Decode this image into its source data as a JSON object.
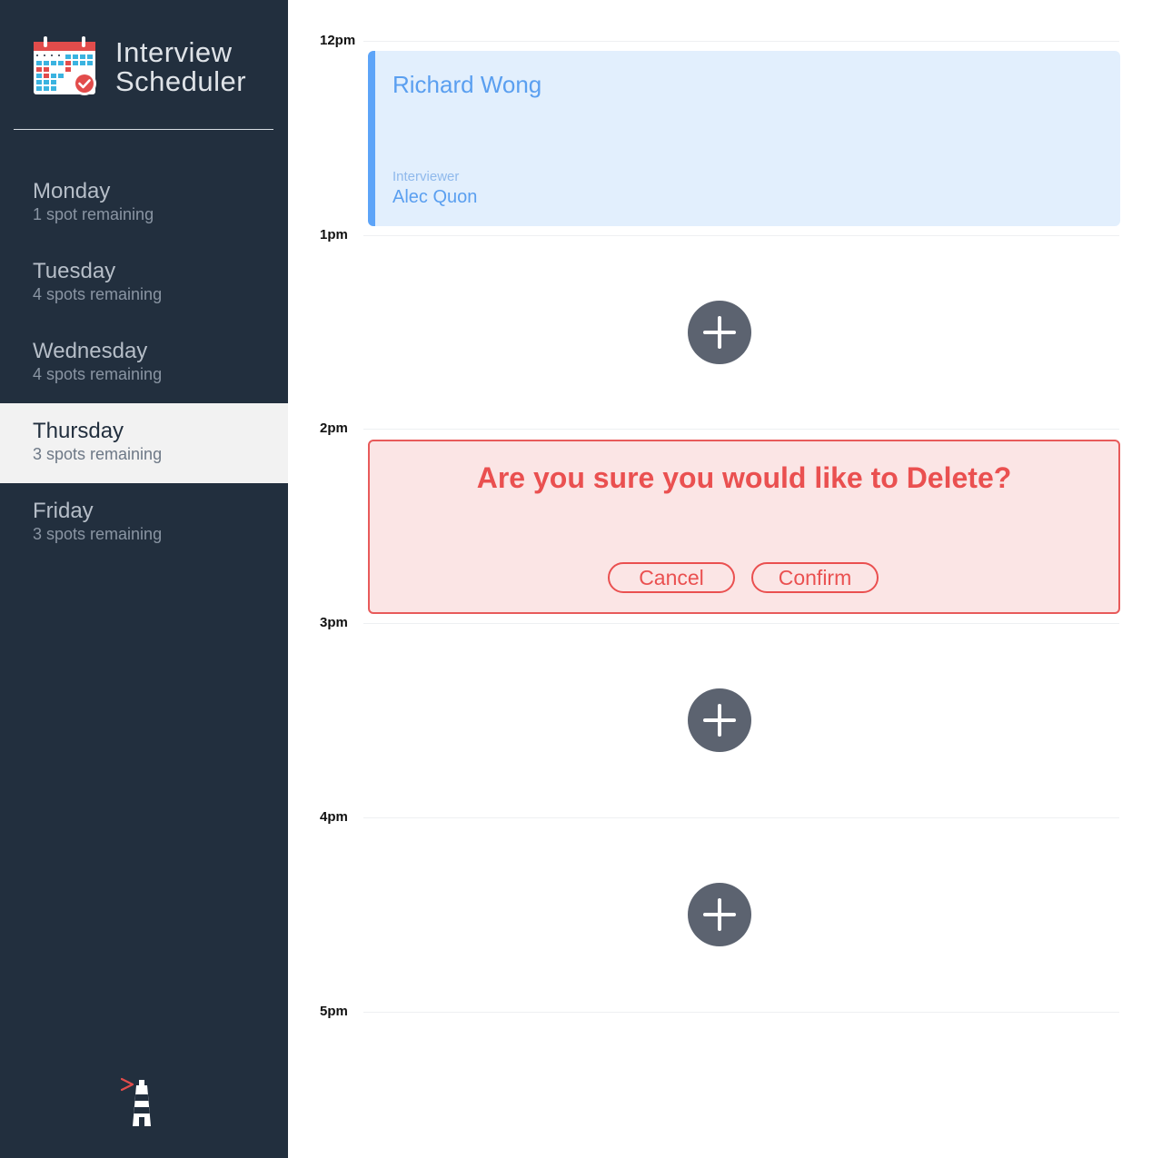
{
  "brand": {
    "title_line1": "Interview",
    "title_line2": "Scheduler"
  },
  "sidebar": {
    "days": [
      {
        "name": "Monday",
        "spots": "1 spot remaining",
        "selected": false
      },
      {
        "name": "Tuesday",
        "spots": "4 spots remaining",
        "selected": false
      },
      {
        "name": "Wednesday",
        "spots": "4 spots remaining",
        "selected": false
      },
      {
        "name": "Thursday",
        "spots": "3 spots remaining",
        "selected": true
      },
      {
        "name": "Friday",
        "spots": "3 spots remaining",
        "selected": false
      }
    ]
  },
  "schedule": {
    "slots": [
      {
        "time": "12pm",
        "type": "appointment",
        "student": "Richard Wong",
        "interviewer_label": "Interviewer",
        "interviewer": "Alec Quon"
      },
      {
        "time": "1pm",
        "type": "empty"
      },
      {
        "time": "2pm",
        "type": "confirm",
        "message": "Are you sure you would like to Delete?",
        "cancel_label": "Cancel",
        "confirm_label": "Confirm"
      },
      {
        "time": "3pm",
        "type": "empty"
      },
      {
        "time": "4pm",
        "type": "empty"
      },
      {
        "time": "5pm",
        "type": "end"
      }
    ]
  },
  "icons": {
    "logo": "calendar-check-icon",
    "add": "plus-icon",
    "footer": "lighthouse-icon"
  },
  "colors": {
    "sidebar_bg": "#222f3e",
    "selected_day_bg": "#f2f2f2",
    "appointment_accent": "#5da4f8",
    "appointment_bg": "#e2effd",
    "danger": "#ea5050",
    "danger_bg": "#fbe5e5",
    "add_button": "#5c6370"
  }
}
